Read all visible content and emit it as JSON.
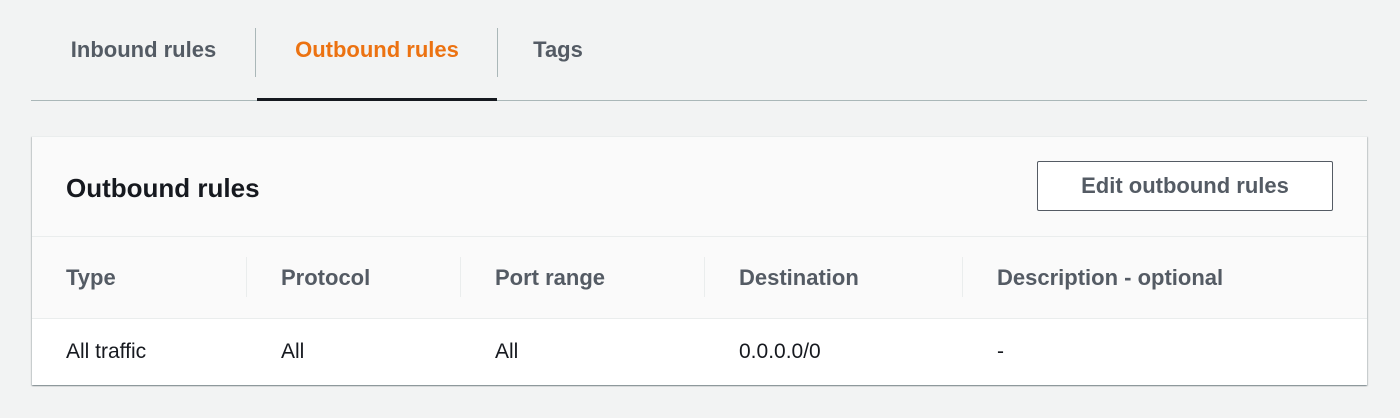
{
  "tabs": [
    {
      "label": "Inbound rules",
      "active": false
    },
    {
      "label": "Outbound rules",
      "active": true
    },
    {
      "label": "Tags",
      "active": false
    }
  ],
  "panel": {
    "title": "Outbound rules",
    "edit_button_label": "Edit outbound rules"
  },
  "table": {
    "columns": [
      "Type",
      "Protocol",
      "Port range",
      "Destination",
      "Description - optional"
    ],
    "rows": [
      {
        "type": "All traffic",
        "protocol": "All",
        "port_range": "All",
        "destination": "0.0.0.0/0",
        "description": "-"
      }
    ]
  },
  "colors": {
    "active_tab": "#ec7211",
    "tab_text": "#545b64",
    "background": "#f2f3f3",
    "text": "#16191f"
  }
}
